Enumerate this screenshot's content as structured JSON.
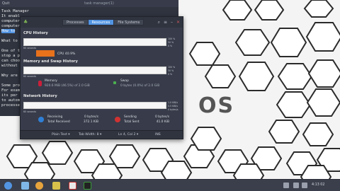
{
  "background_window": {
    "menu_label": "Quit",
    "title": "task manager(1)",
    "lines": [
      "Task Manager",
      "It enabl",
      "computer",
      "computer",
      "How to",
      "",
      "What to",
      "",
      "One of t",
      "stop a p",
      "can choo",
      "without",
      "",
      "Why are",
      "",
      "Some pro",
      "For exam",
      "its per",
      "to autom",
      "processe"
    ],
    "highlight_line_index": 4
  },
  "window": {
    "tabs": [
      {
        "label": "Processes",
        "active": false
      },
      {
        "label": "Resources",
        "active": true
      },
      {
        "label": "File Systems",
        "active": false
      }
    ],
    "buttons": {
      "search": "⌕",
      "menu": "≡",
      "minimize": "–",
      "close": "✕"
    },
    "cpu": {
      "title": "CPU History",
      "graph_right_labels": [
        "100 %",
        "50 %",
        "0 %"
      ],
      "graph_left_label": "60 seconds",
      "legend": "CPU  40.9%",
      "color": "#e8711c"
    },
    "memory": {
      "title": "Memory and Swap History",
      "graph_right_labels": [
        "100 %",
        "50 %",
        "0 %"
      ],
      "graph_left_label": "60 seconds",
      "mem_label": "Memory",
      "mem_value": "920.6 MiB (46.5%) of 2.0 GiB",
      "swap_label": "Swap",
      "swap_value": "0 bytes (0.0%) of 2.0 GiB",
      "mem_color": "#cc1f3a",
      "swap_color": "#4caf50"
    },
    "network": {
      "title": "Network History",
      "graph_right_labels": [
        "1.0 KiB/s",
        "0.5 KiB/s",
        "0 bytes/s"
      ],
      "graph_left_label": "60 seconds",
      "receiving_label": "Receiving",
      "receiving_value": "0 bytes/s",
      "total_received_label": "Total Received",
      "total_received_value": "372.1 KiB",
      "sending_label": "Sending",
      "sending_value": "0 bytes/s",
      "total_sent_label": "Total Sent",
      "total_sent_value": "41.0 KiB",
      "receive_color": "#2f7fd6",
      "send_color": "#d03232"
    },
    "statusbar": {
      "format": "Plain Text",
      "tab_width": "Tab Width: 8",
      "position": "Ln 4, Col 2",
      "mode": "INS"
    }
  },
  "desktop": {
    "watermark": "OS"
  },
  "taskbar": {
    "clock": "4:13 02",
    "icons": [
      "menu-icon",
      "files-icon",
      "browser-icon",
      "folder-icon",
      "document-icon",
      "terminal-icon"
    ]
  }
}
